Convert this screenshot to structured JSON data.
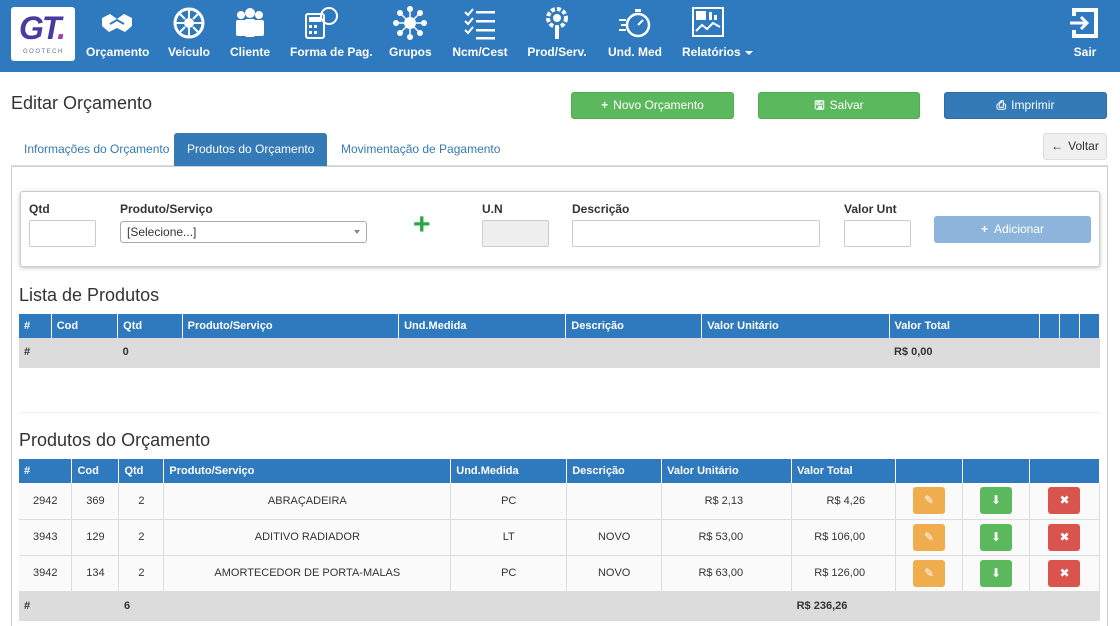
{
  "nav": {
    "logo_text": "GT",
    "logo_sub": "GOOTECH",
    "items": [
      {
        "label": "Orçamento",
        "icon": "handshake-icon"
      },
      {
        "label": "Veículo",
        "icon": "wheel-icon"
      },
      {
        "label": "Cliente",
        "icon": "users-icon"
      },
      {
        "label": "Forma de Pag.",
        "icon": "calculator-icon"
      },
      {
        "label": "Grupos",
        "icon": "network-icon"
      },
      {
        "label": "Ncm/Cest",
        "icon": "checklist-icon"
      },
      {
        "label": "Prod/Serv.",
        "icon": "wrench-gear-icon"
      },
      {
        "label": "Und. Med",
        "icon": "stopwatch-icon"
      },
      {
        "label": "Relatórios",
        "icon": "report-icon"
      }
    ],
    "exit_label": "Sair"
  },
  "page": {
    "title": "Editar Orçamento",
    "new_button": "Novo Orçamento",
    "save_button": "Salvar",
    "print_button": "Imprimir",
    "back_button": "Voltar"
  },
  "tabs": [
    "Informações do Orçamento",
    "Produtos do Orçamento",
    "Movimentação de Pagamento"
  ],
  "form": {
    "qtd_label": "Qtd",
    "produto_label": "Produto/Serviço",
    "produto_value": "[Selecione...]",
    "un_label": "U.N",
    "descricao_label": "Descrição",
    "valor_label": "Valor Unt",
    "add_button": "Adicionar"
  },
  "lista": {
    "title": "Lista de Produtos",
    "headers": [
      "#",
      "Cod",
      "Qtd",
      "Produto/Serviço",
      "Und.Medida",
      "Descrição",
      "Valor Unitário",
      "Valor Total"
    ],
    "footer": {
      "hash": "#",
      "qtd": "0",
      "total": "R$ 0,00"
    }
  },
  "orcamento": {
    "title": "Produtos do Orçamento",
    "headers": [
      "#",
      "Cod",
      "Qtd",
      "Produto/Serviço",
      "Und.Medida",
      "Descrição",
      "Valor Unitário",
      "Valor Total"
    ],
    "rows": [
      {
        "id": "2942",
        "cod": "369",
        "qtd": "2",
        "produto": "ABRAÇADEIRA",
        "und": "PC",
        "descricao": "",
        "unit": "R$ 2,13",
        "total": "R$ 4,26"
      },
      {
        "id": "3943",
        "cod": "129",
        "qtd": "2",
        "produto": "ADITIVO RADIADOR",
        "und": "LT",
        "descricao": "NOVO",
        "unit": "R$ 53,00",
        "total": "R$ 106,00"
      },
      {
        "id": "3942",
        "cod": "134",
        "qtd": "2",
        "produto": "AMORTECEDOR DE PORTA-MALAS",
        "und": "PC",
        "descricao": "NOVO",
        "unit": "R$ 63,00",
        "total": "R$ 126,00"
      }
    ],
    "footer": {
      "hash": "#",
      "qtd": "6",
      "total": "R$ 236,26"
    }
  },
  "colors": {
    "primary": "#2f79be",
    "success": "#5cb85c",
    "warning": "#f0ad4e",
    "danger": "#d9534f"
  }
}
